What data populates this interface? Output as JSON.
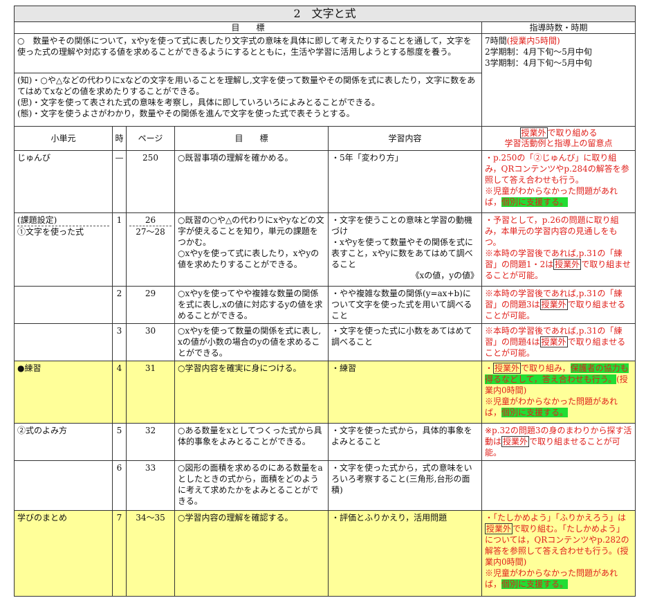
{
  "title": "2　文字と式",
  "goals_header": "目　　標",
  "hours_header": "指導時数・時期",
  "main_goal": "○　数量やその関係について，xやyを使って式に表したり文字式の意味を具体に即して考えたりすることを通して，文字を使った式の理解や対応する値を求めることができるようにするとともに，生活や学習に活用しようとする態度を養う。",
  "hours": {
    "total_prefix": "7時間",
    "total_note": "(授業内5時間)",
    "term2": "2学期制：4月下旬〜5月中旬",
    "term3": "3学期制：4月下旬〜5月中旬"
  },
  "sub_goals": [
    {
      "tag": "(知)",
      "text": "・○や△などの代わりにxなどの文字を用いることを理解し,文字を使って数量やその関係を式に表したり，文字に数をあてはめてxなどの値を求めたりすることができる。"
    },
    {
      "tag": "(思)",
      "text": "・文字を使って表された式の意味を考察し，具体に即していろいろによみとることができる。"
    },
    {
      "tag": "(態)",
      "text": "・文字を使うよさがわかり，数量やその関係を進んで文字を使った式で表そうとする。"
    }
  ],
  "columns": {
    "unit": "小単元",
    "hour": "時",
    "page": "ページ",
    "goal": "目　　標",
    "content": "学習内容",
    "note_box": "授業外",
    "note_line1": "で取り組める",
    "note_line2": "学習活動例と指導上の留意点"
  },
  "rows": [
    {
      "unit": "じゅんび",
      "hour": "—",
      "page": "250",
      "goal": "○既習事項の理解を確かめる。",
      "content": "・5年「変わり方」",
      "note_a": "・p.250の「②じゅんび」に取り組み，QRコンテンツやp.284の解答を参照して答え合わせも行う。",
      "note_b": "※児童がわからなかった問題があれば，",
      "note_b_hl": "個別に支援する。"
    },
    {
      "unit": "(課題設定)",
      "unit2": "①文字を使った式",
      "hour": "1",
      "page": "26",
      "page2": "27〜28",
      "goal": "○既習の○や△の代わりにxやyなどの文字が使えることを知り，単元の課題をつかむ。",
      "goal2": "○xやyを使って式に表したり，xやyの値を求めたりすることができる。",
      "content": "・文字を使うことの意味と学習の動機づけ",
      "content2": "・xやyを使って数量やその関係を式に表すこと，xやyに数をあてはめて調べること",
      "content3": "《xの値，yの値》",
      "note_a": "・予習として，p.26の問題に取り組み，本単元の学習内容の見通しをもつ。",
      "note_b": "※本時の学習後であれば,p.31の「練習」の問題1・2は",
      "note_box": "授業外",
      "note_c": "で取り組ませることが可能。"
    },
    {
      "hour": "2",
      "page": "29",
      "goal": "○xやyを使ってやや複雑な数量の関係を式に表し,xの値に対応するyの値を求めることができる。",
      "content": "・やや複雑な数量の関係(y=ax+b)について文字を使った式を用いて調べること",
      "note_b": "※本時の学習後であれば,p.31の「練習」の問題3は",
      "note_box": "授業外",
      "note_c": "で取り組ませることが可能。"
    },
    {
      "hour": "3",
      "page": "30",
      "goal": "○xやyを使って数量の関係を式に表し,xの値が小数の場合のyの値を求めることができる。",
      "content": "・文字を使った式に小数をあてはめて調べること",
      "note_b": "※本時の学習後であれば,p.31の「練習」の問題4は",
      "note_box": "授業外",
      "note_c": "で取り組ませることが可能。"
    },
    {
      "unit": "●練習",
      "hour": "4",
      "page": "31",
      "goal": "○学習内容を確実に身につける。",
      "content": "・練習",
      "note_box": "授業外",
      "note_a": "で取り組み，",
      "note_a_hl": "保護者の協力も得るなどして，答え合わせも行う。",
      "note_a2": "(授業内0時間)",
      "note_b": "※児童がわからなかった問題があれば，",
      "note_b_hl": "個別に支援する。"
    },
    {
      "unit": "②式のよみ方",
      "hour": "5",
      "page": "32",
      "goal": "○ある数量をxとしてつくった式から具体的事象をよみとることができる。",
      "content": "・文字を使った式から，具体的事象をよみとること",
      "note_b": "※p.32の問題3の身のまわりから探す活動は",
      "note_box": "授業外",
      "note_c": "で取り組ませることが可能。"
    },
    {
      "hour": "6",
      "page": "33",
      "goal": "○図形の面積を求めるのにある数量をaとしたときの式から，面積をどのように考えて求めたかをよみとることができる。",
      "content": "・文字を使った式から，式の意味をいろいろ考察すること(三角形,台形の面積)"
    },
    {
      "unit": "学びのまとめ",
      "hour": "7",
      "page": "34〜35",
      "goal": "○学習内容の理解を確認する。",
      "content": "・評価とふりかえり，活用問題",
      "note_a": "・「たしかめよう」「ふりかえろう」は",
      "note_box": "授業外",
      "note_a2": "で取り組む。「たしかめよう」については，QRコンテンツやp.282の解答を参照して答え合わせも行う。(授業内0時間)",
      "note_b": "※児童がわからなかった問題があれば，",
      "note_b_hl": "個別に支援する。"
    }
  ]
}
